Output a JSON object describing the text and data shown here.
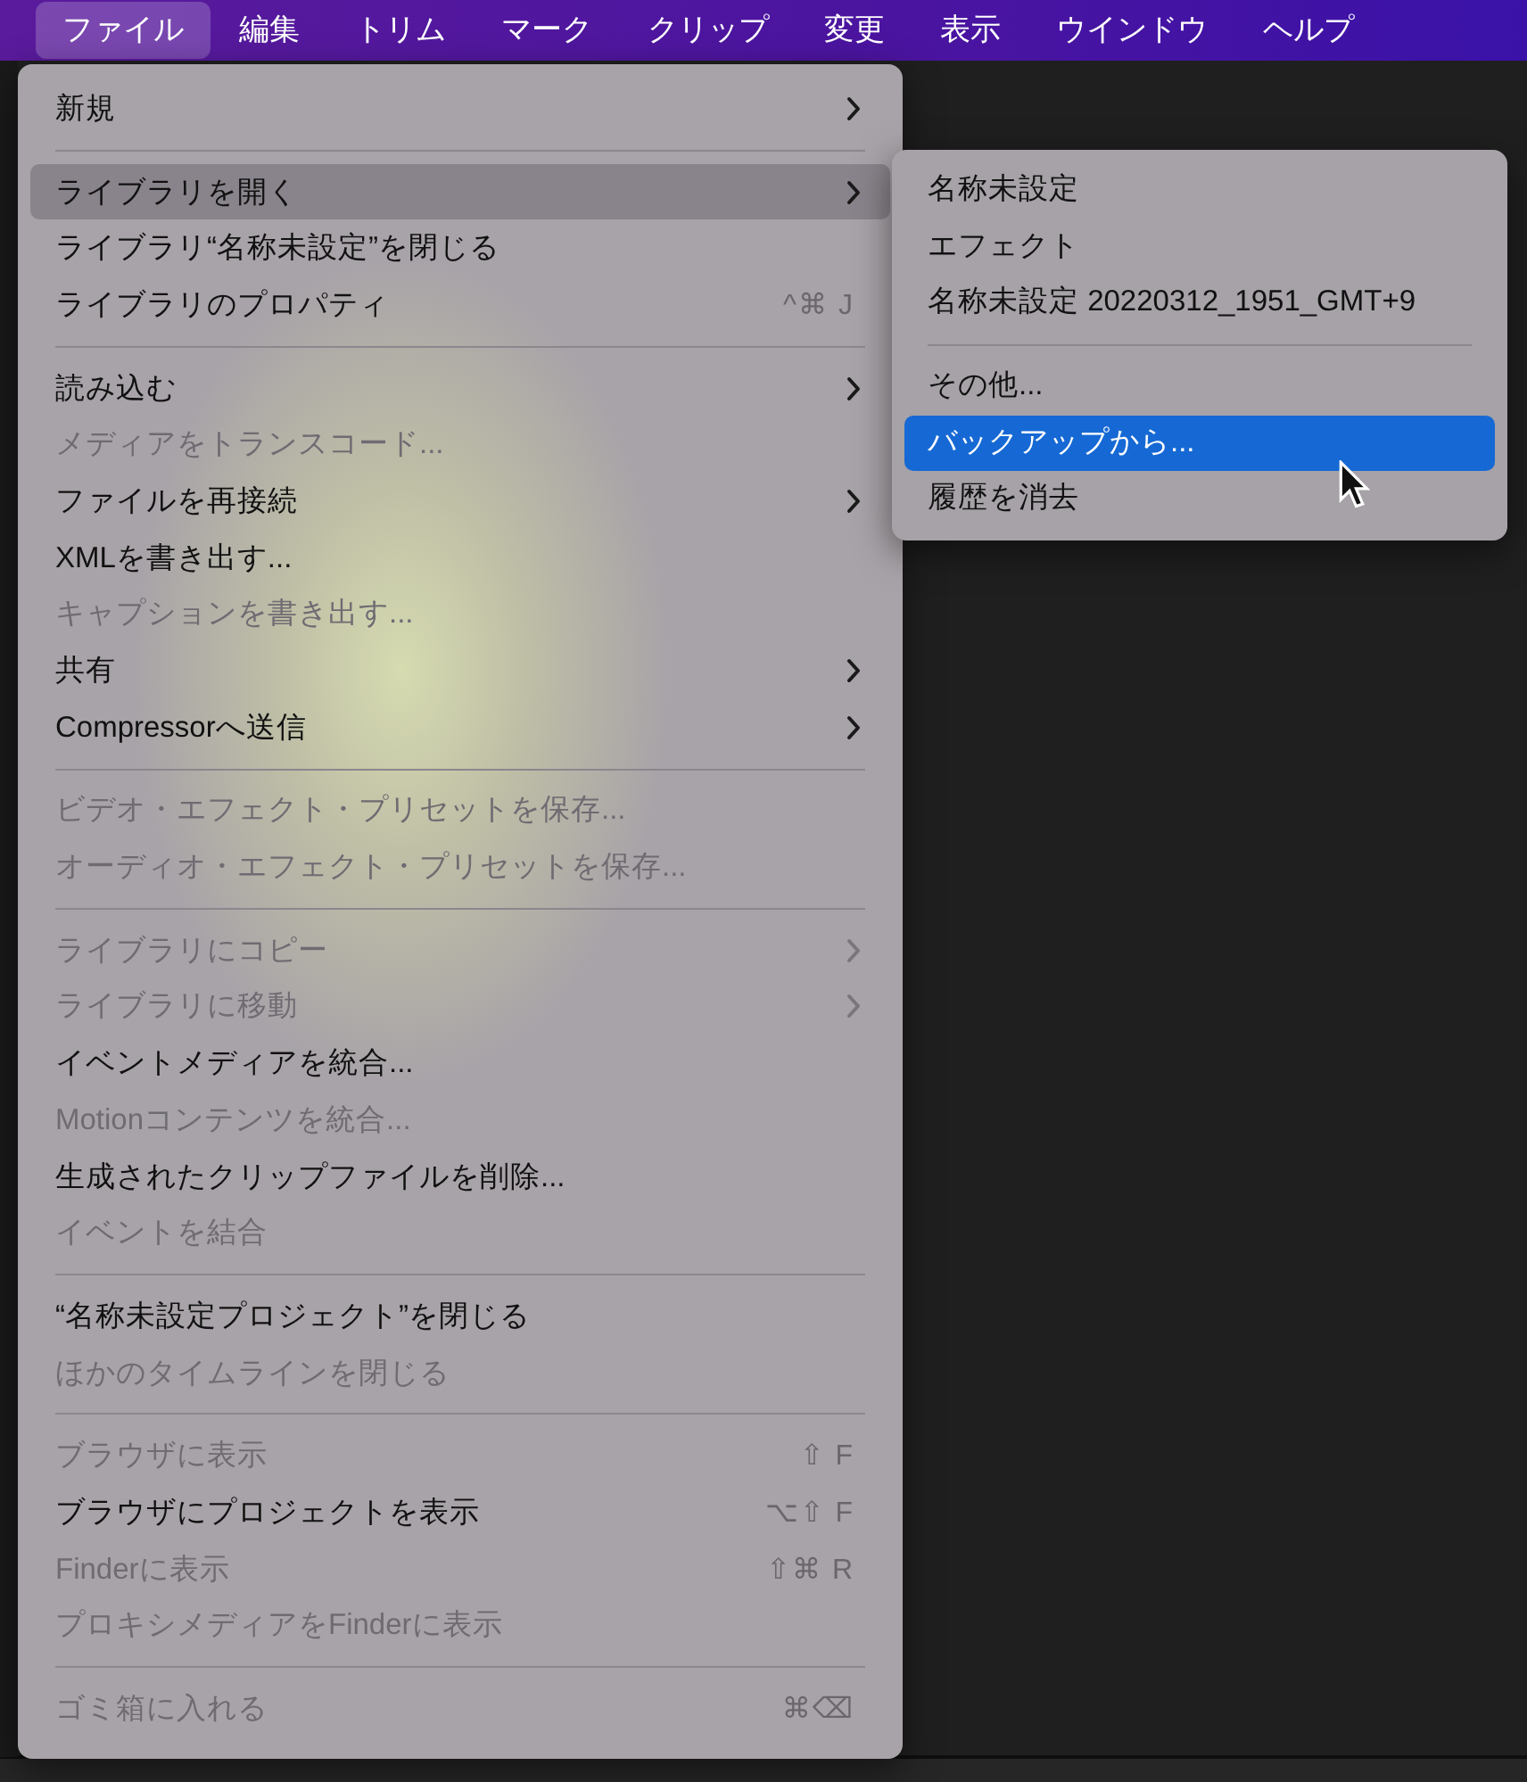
{
  "menu_bar": {
    "items": [
      {
        "label": "ファイル",
        "selected": true
      },
      {
        "label": "編集",
        "selected": false
      },
      {
        "label": "トリム",
        "selected": false
      },
      {
        "label": "マーク",
        "selected": false
      },
      {
        "label": "クリップ",
        "selected": false
      },
      {
        "label": "変更",
        "selected": false
      },
      {
        "label": "表示",
        "selected": false
      },
      {
        "label": "ウインドウ",
        "selected": false
      },
      {
        "label": "ヘルプ",
        "selected": false
      }
    ]
  },
  "menu": {
    "groups": [
      [
        {
          "label": "新規",
          "disabled": false,
          "submenu": true,
          "highlighted": false
        }
      ],
      [
        {
          "label": "ライブラリを開く",
          "disabled": false,
          "submenu": true,
          "highlighted": true
        },
        {
          "label": "ライブラリ“名称未設定”を閉じる",
          "disabled": false,
          "submenu": false,
          "highlighted": false
        },
        {
          "label": "ライブラリのプロパティ",
          "disabled": false,
          "submenu": false,
          "highlighted": false,
          "shortcut": "^⌘ J"
        }
      ],
      [
        {
          "label": "読み込む",
          "disabled": false,
          "submenu": true,
          "highlighted": false
        },
        {
          "label": "メディアをトランスコード...",
          "disabled": true,
          "submenu": false,
          "highlighted": false
        },
        {
          "label": "ファイルを再接続",
          "disabled": false,
          "submenu": true,
          "highlighted": false
        },
        {
          "label": "XMLを書き出す...",
          "disabled": false,
          "submenu": false,
          "highlighted": false
        },
        {
          "label": "キャプションを書き出す...",
          "disabled": true,
          "submenu": false,
          "highlighted": false
        },
        {
          "label": "共有",
          "disabled": false,
          "submenu": true,
          "highlighted": false
        },
        {
          "label": "Compressorへ送信",
          "disabled": false,
          "submenu": true,
          "highlighted": false
        }
      ],
      [
        {
          "label": "ビデオ・エフェクト・プリセットを保存...",
          "disabled": true,
          "submenu": false,
          "highlighted": false
        },
        {
          "label": "オーディオ・エフェクト・プリセットを保存...",
          "disabled": true,
          "submenu": false,
          "highlighted": false
        }
      ],
      [
        {
          "label": "ライブラリにコピー",
          "disabled": true,
          "submenu": true,
          "highlighted": false
        },
        {
          "label": "ライブラリに移動",
          "disabled": true,
          "submenu": true,
          "highlighted": false
        },
        {
          "label": "イベントメディアを統合...",
          "disabled": false,
          "submenu": false,
          "highlighted": false
        },
        {
          "label": "Motionコンテンツを統合...",
          "disabled": true,
          "submenu": false,
          "highlighted": false
        },
        {
          "label": "生成されたクリップファイルを削除...",
          "disabled": false,
          "submenu": false,
          "highlighted": false
        },
        {
          "label": "イベントを結合",
          "disabled": true,
          "submenu": false,
          "highlighted": false
        }
      ],
      [
        {
          "label": "“名称未設定プロジェクト”を閉じる",
          "disabled": false,
          "submenu": false,
          "highlighted": false
        },
        {
          "label": "ほかのタイムラインを閉じる",
          "disabled": true,
          "submenu": false,
          "highlighted": false
        }
      ],
      [
        {
          "label": "ブラウザに表示",
          "disabled": true,
          "submenu": false,
          "highlighted": false,
          "shortcut": "⇧ F"
        },
        {
          "label": "ブラウザにプロジェクトを表示",
          "disabled": false,
          "submenu": false,
          "highlighted": false,
          "shortcut": "⌥⇧ F"
        },
        {
          "label": "Finderに表示",
          "disabled": true,
          "submenu": false,
          "highlighted": false,
          "shortcut": "⇧⌘ R"
        },
        {
          "label": "プロキシメディアをFinderに表示",
          "disabled": true,
          "submenu": false,
          "highlighted": false
        }
      ],
      [
        {
          "label": "ゴミ箱に入れる",
          "disabled": true,
          "submenu": false,
          "highlighted": false,
          "shortcut": "⌘⌫"
        }
      ]
    ]
  },
  "submenu": {
    "groups": [
      [
        {
          "label": "名称未設定",
          "selected": false
        },
        {
          "label": "エフェクト",
          "selected": false
        },
        {
          "label": "名称未設定 20220312_1951_GMT+9",
          "selected": false
        }
      ],
      [
        {
          "label": "その他...",
          "selected": false
        },
        {
          "label": "バックアップから...",
          "selected": true
        },
        {
          "label": "履歴を消去",
          "selected": false
        }
      ]
    ]
  }
}
